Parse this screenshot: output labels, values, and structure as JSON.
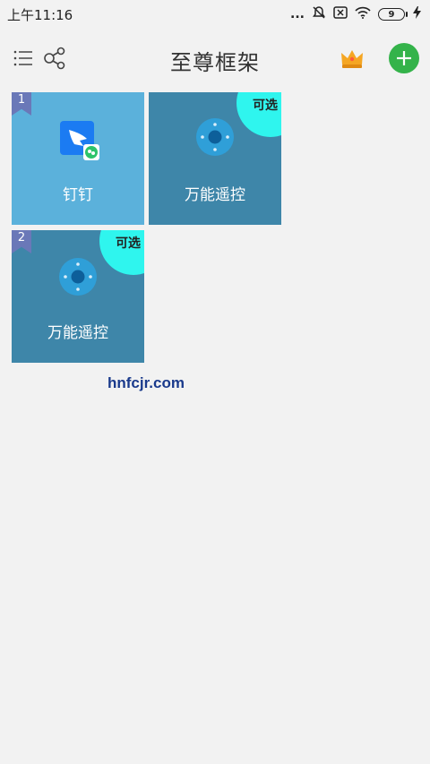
{
  "status_bar": {
    "time": "上午11:16",
    "dots": "...",
    "battery_level": "9"
  },
  "header": {
    "title": "至尊框架",
    "add_label": "+"
  },
  "tiles": [
    {
      "label": "钉钉",
      "badge": "1",
      "optional_text": ""
    },
    {
      "label": "万能遥控",
      "badge": "",
      "optional_text": "可选"
    },
    {
      "label": "万能遥控",
      "badge": "2",
      "optional_text": "可选"
    }
  ],
  "watermark": "hnfcjr.com",
  "colors": {
    "background": "#f2f2f2",
    "tile_light": "#5bb1db",
    "tile_dark": "#3e86a9",
    "badge": "#6a78b8",
    "optional_corner": "#2ff5ee",
    "add_button": "#34b34a"
  },
  "icons": {
    "menu": "list-menu-icon",
    "share": "share-icon",
    "crown": "crown-icon",
    "add": "plus-icon",
    "dingtalk": "dingtalk-app-icon",
    "remote": "remote-control-icon"
  }
}
